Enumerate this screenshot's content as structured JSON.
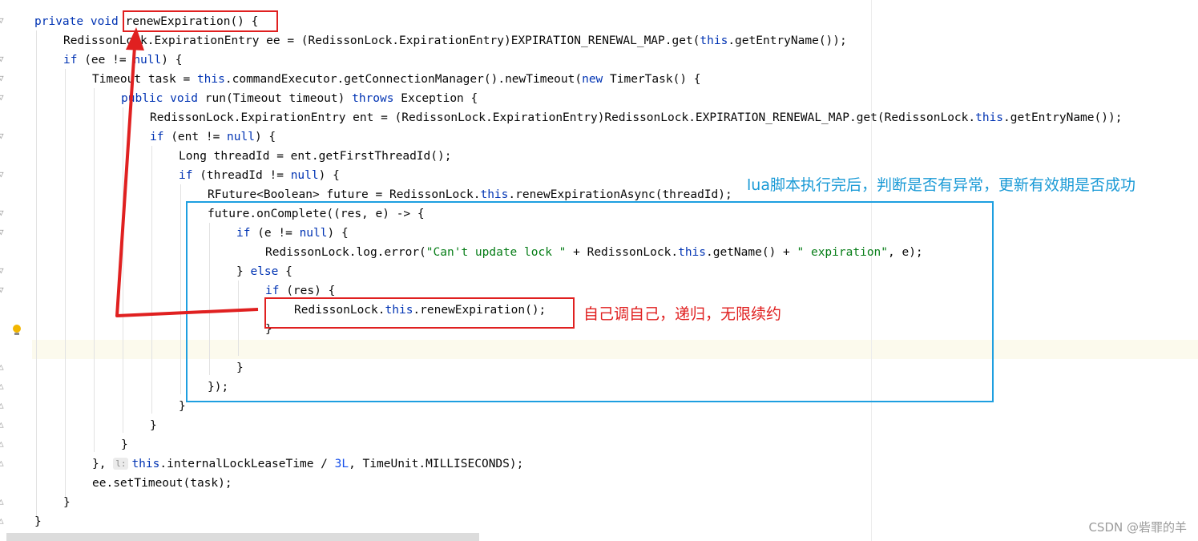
{
  "editor": {
    "lines": [
      {
        "segs": [
          {
            "t": "private void ",
            "c": "kw"
          },
          {
            "t": "renewExpiration() {"
          }
        ]
      },
      {
        "segs": [
          {
            "t": "RedissonLock.ExpirationEntry ee = (RedissonLock.ExpirationEntry)EXPIRATION_RENEWAL_MAP.get("
          },
          {
            "t": "this",
            "c": "kw"
          },
          {
            "t": ".getEntryName());"
          }
        ]
      },
      {
        "segs": [
          {
            "t": "if",
            "c": "kw"
          },
          {
            "t": " (ee != "
          },
          {
            "t": "null",
            "c": "kw"
          },
          {
            "t": ") {"
          }
        ]
      },
      {
        "segs": [
          {
            "t": "Timeout task = "
          },
          {
            "t": "this",
            "c": "kw"
          },
          {
            "t": ".commandExecutor.getConnectionManager().newTimeout("
          },
          {
            "t": "new",
            "c": "kw"
          },
          {
            "t": " TimerTask() {"
          }
        ]
      },
      {
        "segs": [
          {
            "t": "public void ",
            "c": "kw"
          },
          {
            "t": "run(Timeout timeout) "
          },
          {
            "t": "throws",
            "c": "kw"
          },
          {
            "t": " Exception {"
          }
        ]
      },
      {
        "segs": [
          {
            "t": "RedissonLock.ExpirationEntry ent = (RedissonLock.ExpirationEntry)RedissonLock.EXPIRATION_RENEWAL_MAP.get(RedissonLock."
          },
          {
            "t": "this",
            "c": "kw"
          },
          {
            "t": ".getEntryName());"
          }
        ]
      },
      {
        "segs": [
          {
            "t": "if",
            "c": "kw"
          },
          {
            "t": " (ent != "
          },
          {
            "t": "null",
            "c": "kw"
          },
          {
            "t": ") {"
          }
        ]
      },
      {
        "segs": [
          {
            "t": "Long threadId = ent.getFirstThreadId();"
          }
        ]
      },
      {
        "segs": [
          {
            "t": "if",
            "c": "kw"
          },
          {
            "t": " (threadId != "
          },
          {
            "t": "null",
            "c": "kw"
          },
          {
            "t": ") {"
          }
        ]
      },
      {
        "segs": [
          {
            "t": "RFuture<Boolean> future = RedissonLock."
          },
          {
            "t": "this",
            "c": "kw"
          },
          {
            "t": ".renewExpirationAsync(threadId);"
          }
        ]
      },
      {
        "segs": [
          {
            "t": "future.onComplete((res, e) -> {"
          }
        ]
      },
      {
        "segs": [
          {
            "t": "if",
            "c": "kw"
          },
          {
            "t": " (e != "
          },
          {
            "t": "null",
            "c": "kw"
          },
          {
            "t": ") {"
          }
        ]
      },
      {
        "segs": [
          {
            "t": "RedissonLock.log.error("
          },
          {
            "t": "\"Can't update lock \"",
            "c": "str"
          },
          {
            "t": " + RedissonLock."
          },
          {
            "t": "this",
            "c": "kw"
          },
          {
            "t": ".getName() + "
          },
          {
            "t": "\" expiration\"",
            "c": "str"
          },
          {
            "t": ", e);"
          }
        ]
      },
      {
        "segs": [
          {
            "t": "} "
          },
          {
            "t": "else",
            "c": "kw"
          },
          {
            "t": " {"
          }
        ]
      },
      {
        "segs": [
          {
            "t": "if",
            "c": "kw"
          },
          {
            "t": " (res) {"
          }
        ]
      },
      {
        "segs": [
          {
            "t": "RedissonLock."
          },
          {
            "t": "this",
            "c": "kw"
          },
          {
            "t": ".renewExpiration();"
          }
        ]
      },
      {
        "segs": [
          {
            "t": "}"
          }
        ]
      },
      {
        "segs": []
      },
      {
        "segs": [
          {
            "t": "}"
          }
        ]
      },
      {
        "segs": [
          {
            "t": "});"
          }
        ]
      },
      {
        "segs": [
          {
            "t": "}"
          }
        ]
      },
      {
        "segs": [
          {
            "t": "}"
          }
        ]
      },
      {
        "segs": [
          {
            "t": "}"
          }
        ]
      },
      {
        "segs": [
          {
            "t": "}, "
          },
          {
            "t": "l:",
            "c": "hint"
          },
          {
            "t": "this",
            "c": "kw"
          },
          {
            "t": ".internalLockLeaseTime / "
          },
          {
            "t": "3L",
            "c": "num"
          },
          {
            "t": ", TimeUnit.MILLISECONDS);"
          }
        ]
      },
      {
        "segs": [
          {
            "t": "ee.setTimeout(task);"
          }
        ]
      },
      {
        "segs": [
          {
            "t": "}"
          }
        ]
      },
      {
        "segs": [
          {
            "t": "}"
          }
        ]
      }
    ]
  },
  "annotations": {
    "blue_note": "lua脚本执行完后，判断是否有异常，更新有效期是否成功",
    "red_note": "自己调自己，递归，无限续约"
  },
  "colors": {
    "keyword": "#0033b3",
    "string": "#067d17",
    "number": "#1750eb",
    "annotation_red": "#e02020",
    "annotation_blue": "#1e9fe0"
  },
  "icons": {
    "gutter": "fold-icon",
    "intention": "lightbulb-icon"
  },
  "watermark": "CSDN @砦罪的羊"
}
